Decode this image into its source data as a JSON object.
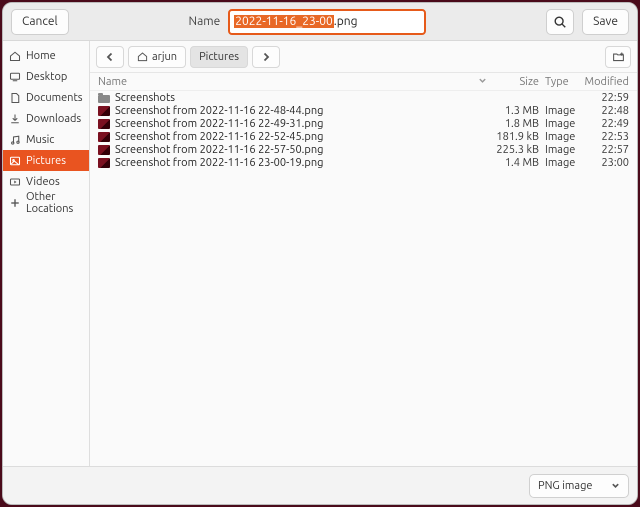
{
  "header": {
    "cancel_label": "Cancel",
    "name_label": "Name",
    "filename_selected": "2022-11-16_23-00",
    "filename_ext": ".png",
    "save_label": "Save"
  },
  "sidebar": {
    "items": [
      {
        "icon": "home-icon",
        "label": "Home"
      },
      {
        "icon": "desktop-icon",
        "label": "Desktop"
      },
      {
        "icon": "documents-icon",
        "label": "Documents"
      },
      {
        "icon": "downloads-icon",
        "label": "Downloads"
      },
      {
        "icon": "music-icon",
        "label": "Music"
      },
      {
        "icon": "pictures-icon",
        "label": "Pictures"
      },
      {
        "icon": "videos-icon",
        "label": "Videos"
      },
      {
        "icon": "plus-icon",
        "label": "Other Locations"
      }
    ],
    "active_index": 5
  },
  "pathbar": {
    "crumbs": [
      {
        "icon": "home-icon",
        "label": "arjun",
        "active": false
      },
      {
        "icon": null,
        "label": "Pictures",
        "active": true
      }
    ]
  },
  "columns": {
    "name": "Name",
    "size": "Size",
    "type": "Type",
    "modified": "Modified"
  },
  "files": [
    {
      "icon": "folder",
      "name": "Screenshots",
      "size": "",
      "type": "",
      "modified": "22:59"
    },
    {
      "icon": "img",
      "name": "Screenshot from 2022-11-16 22-48-44.png",
      "size": "1.3 MB",
      "type": "Image",
      "modified": "22:48"
    },
    {
      "icon": "img",
      "name": "Screenshot from 2022-11-16 22-49-31.png",
      "size": "1.8 MB",
      "type": "Image",
      "modified": "22:49"
    },
    {
      "icon": "img",
      "name": "Screenshot from 2022-11-16 22-52-45.png",
      "size": "181.9 kB",
      "type": "Image",
      "modified": "22:53"
    },
    {
      "icon": "img",
      "name": "Screenshot from 2022-11-16 22-57-50.png",
      "size": "225.3 kB",
      "type": "Image",
      "modified": "22:57"
    },
    {
      "icon": "img",
      "name": "Screenshot from 2022-11-16 23-00-19.png",
      "size": "1.4 MB",
      "type": "Image",
      "modified": "23:00"
    }
  ],
  "footer": {
    "filetype_label": "PNG image"
  }
}
